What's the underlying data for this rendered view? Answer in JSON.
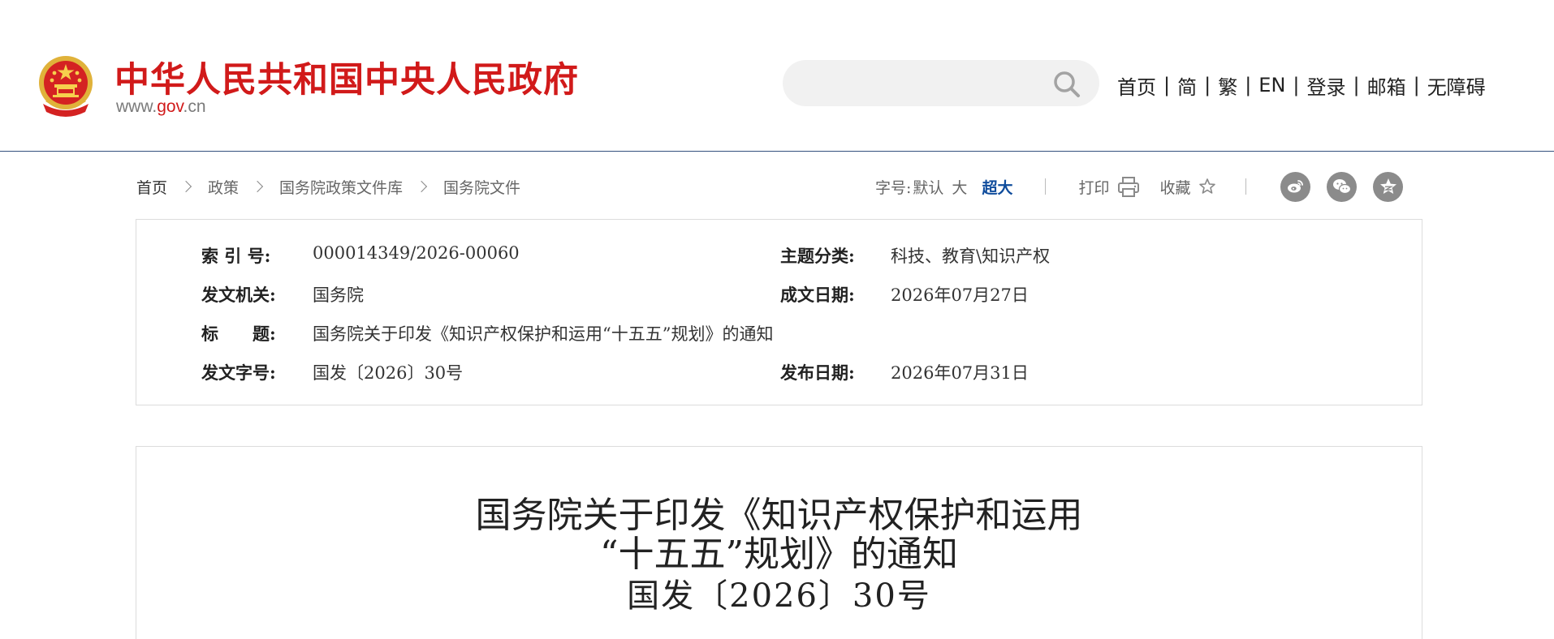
{
  "header": {
    "site_title": "中华人民共和国中央人民政府",
    "site_url_prefix": "www.",
    "site_url_highlight": "gov",
    "site_url_suffix": ".cn",
    "search": {
      "placeholder": "",
      "icon": "search-icon"
    },
    "nav": [
      "首页",
      "简",
      "繁",
      "EN",
      "登录",
      "邮箱",
      "无障碍"
    ],
    "nav_separator": "|"
  },
  "breadcrumb": [
    "首页",
    "政策",
    "国务院政策文件库",
    "国务院文件"
  ],
  "tools": {
    "font_size_label": "字号:",
    "font_sizes": [
      "默认",
      "大",
      "超大"
    ],
    "active_font_size": "超大",
    "print_label": "打印",
    "favorite_label": "收藏",
    "share_icons": [
      "weibo-icon",
      "wechat-icon",
      "qzone-icon"
    ]
  },
  "meta": {
    "index_label": "索 引 号:",
    "index_value": "000014349/2026-00060",
    "topic_label": "主题分类:",
    "topic_value": "科技、教育\\知识产权",
    "issuer_label": "发文机关:",
    "issuer_value": "国务院",
    "written_date_label": "成文日期:",
    "written_date_value": "2026年07月27日",
    "title_label": "标　　题:",
    "title_value": "国务院关于印发《知识产权保护和运用“十五五”规划》的通知",
    "docno_label": "发文字号:",
    "docno_value": "国发〔2026〕30号",
    "publish_date_label": "发布日期:",
    "publish_date_value": "2026年07月31日"
  },
  "article": {
    "title_line1": "国务院关于印发《知识产权保护和运用",
    "title_line2": "“十五五”规划》的通知",
    "doc_number": "国发〔2026〕30号"
  },
  "colors": {
    "brand_red": "#d11a1a",
    "accent_blue": "#0f4c9c",
    "header_rule": "#33507e"
  }
}
